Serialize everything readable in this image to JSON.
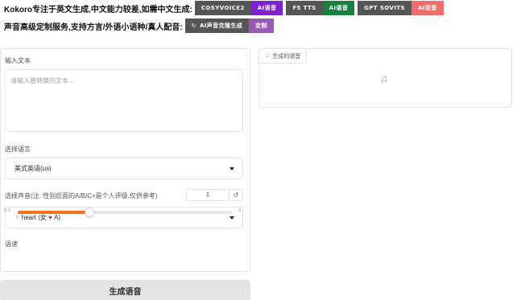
{
  "banner": {
    "line1_text": "Kokoro专注于英文生成,中文能力较差,如需中文生成:",
    "line2_text": "声音高级定制服务,支持方言/外语小语种/真人配音:",
    "badges1": [
      {
        "left": "COSYVOICE2",
        "right": "AI语音",
        "right_color": "#7e22ce"
      },
      {
        "left": "F5 TTS",
        "right": "AI语音",
        "right_color": "#16803c"
      },
      {
        "left": "GPT SOVITS",
        "right": "AI语音",
        "right_color": "#f46d6d"
      }
    ],
    "badges2": [
      {
        "left": "AI声音克隆生成",
        "right": "定制",
        "right_color": "#9b59b6",
        "icon": "refresh-icon"
      }
    ]
  },
  "form": {
    "input_label": "输入文本",
    "input_placeholder": "请输入要转换的文本...",
    "language_label": "选择语言",
    "language_value": "美式英语(us)",
    "voice_label": "选择声音(注: 性别后面的A/B/C+是个人评级,仅供参考)",
    "voice_value_prefix": "heart (女",
    "voice_value_suffix": "A)",
    "speed_label": "语速",
    "speed_value": "1",
    "speed_min": "0.5",
    "speed_max": "2",
    "speed_fraction": 0.333,
    "generate_label": "生成语音"
  },
  "output": {
    "tag_label": "生成的语音",
    "icon": "music-note-icon"
  }
}
